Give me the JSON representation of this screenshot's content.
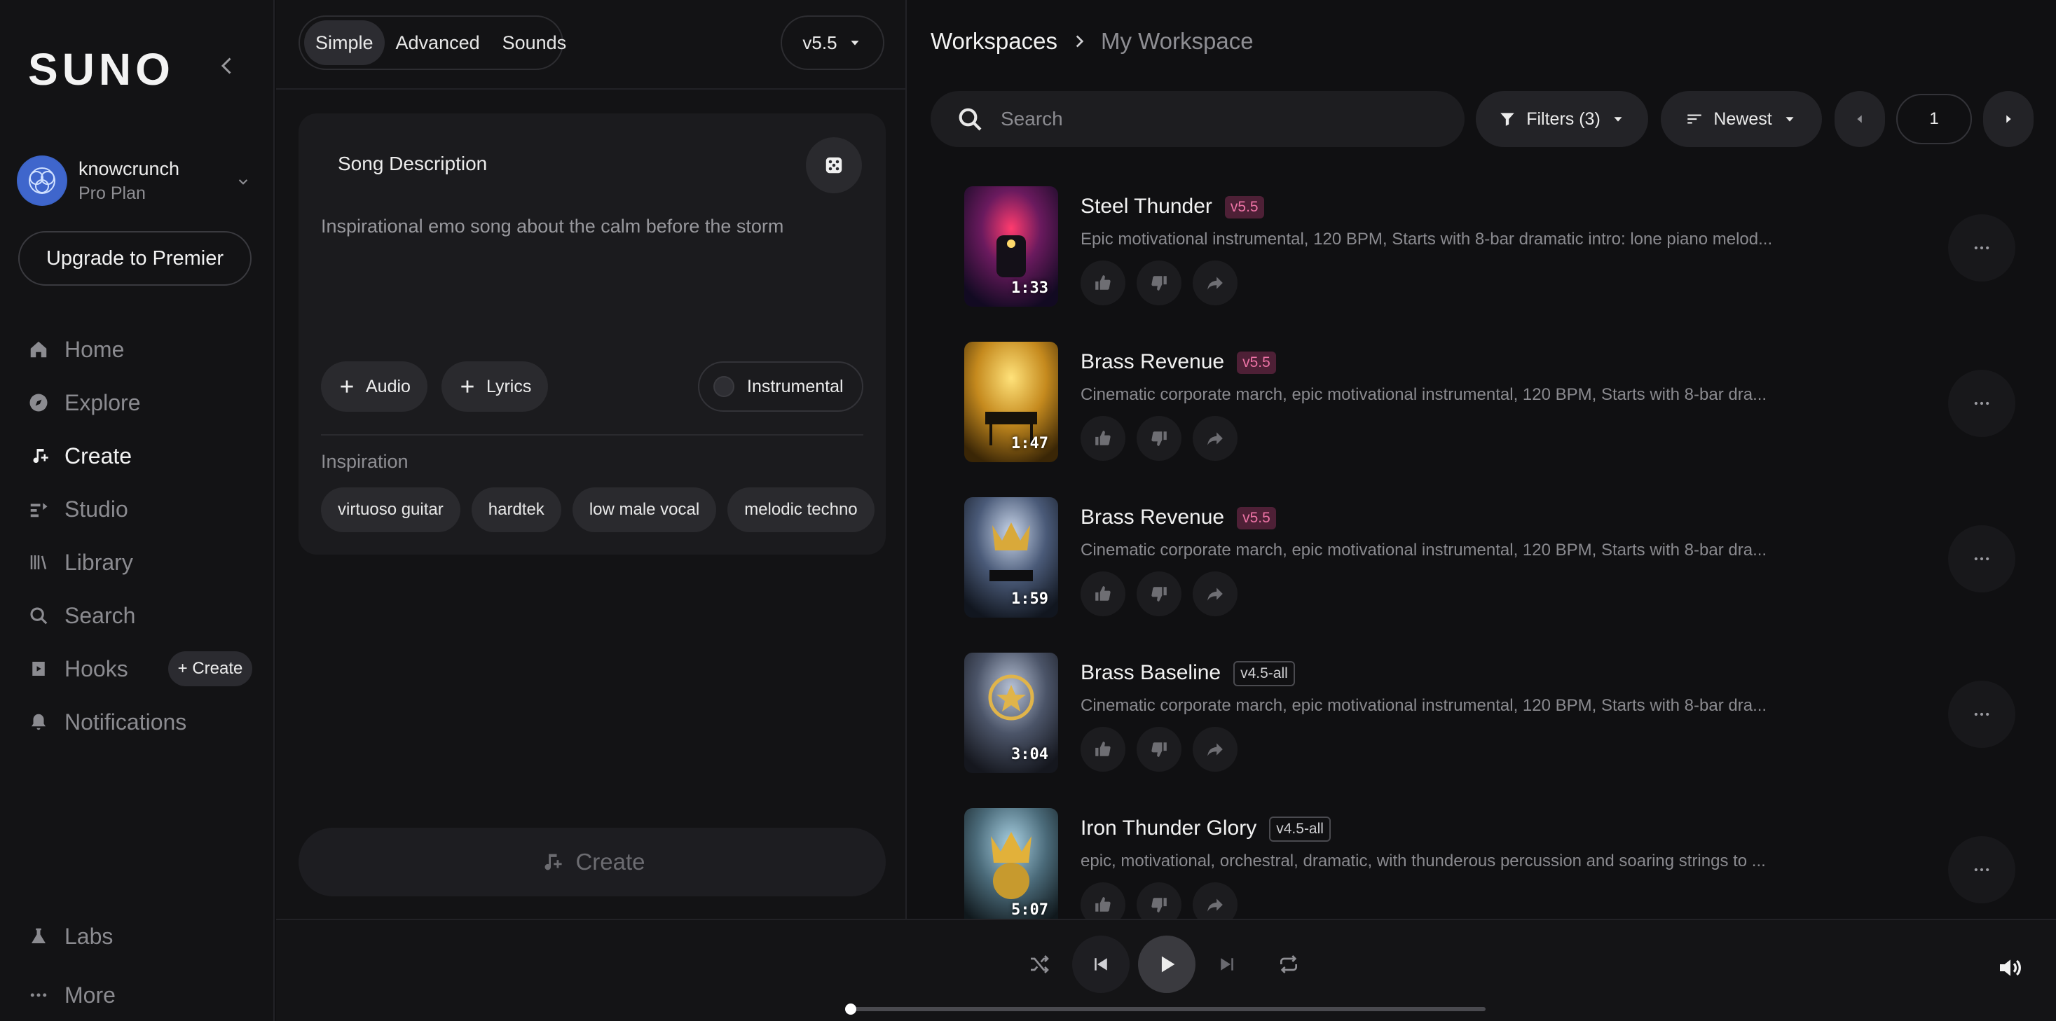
{
  "app": {
    "logo": "SUNO"
  },
  "profile": {
    "name": "knowcrunch",
    "plan": "Pro Plan"
  },
  "sidebar": {
    "upgrade_label": "Upgrade to Premier",
    "items": [
      {
        "label": "Home",
        "icon": "home-icon"
      },
      {
        "label": "Explore",
        "icon": "compass-icon"
      },
      {
        "label": "Create",
        "icon": "music-plus-icon",
        "active": true
      },
      {
        "label": "Studio",
        "icon": "studio-icon"
      },
      {
        "label": "Library",
        "icon": "library-icon"
      },
      {
        "label": "Search",
        "icon": "search-icon"
      },
      {
        "label": "Hooks",
        "icon": "hooks-icon"
      },
      {
        "label": "Notifications",
        "icon": "bell-icon"
      }
    ],
    "hooks_create_label": "+ Create",
    "labs_label": "Labs",
    "more_label": "More"
  },
  "create": {
    "tabs": [
      "Simple",
      "Advanced",
      "Sounds"
    ],
    "active_tab": "Simple",
    "version": "v5.5",
    "description_title": "Song Description",
    "description_value": "Inspirational emo song about the calm before the storm",
    "audio_label": "Audio",
    "lyrics_label": "Lyrics",
    "instrumental_label": "Instrumental",
    "inspiration_label": "Inspiration",
    "inspiration_chips": [
      "virtuoso guitar",
      "hardtek",
      "low male vocal",
      "melodic techno",
      ""
    ],
    "create_label": "Create"
  },
  "workspace": {
    "breadcrumb_root": "Workspaces",
    "breadcrumb_current": "My Workspace",
    "search_placeholder": "Search",
    "filters_label": "Filters (3)",
    "sort_label": "Newest",
    "page": "1"
  },
  "songs": [
    {
      "title": "Steel Thunder",
      "version": "v5.5",
      "badge": "pink",
      "duration": "1:33",
      "description": "Epic motivational instrumental, 120 BPM, Starts with 8-bar dramatic intro: lone piano melod..."
    },
    {
      "title": "Brass Revenue",
      "version": "v5.5",
      "badge": "pink",
      "duration": "1:47",
      "description": "Cinematic corporate march, epic motivational instrumental, 120 BPM, Starts with 8-bar dra..."
    },
    {
      "title": "Brass Revenue",
      "version": "v5.5",
      "badge": "pink",
      "duration": "1:59",
      "description": "Cinematic corporate march, epic motivational instrumental, 120 BPM, Starts with 8-bar dra..."
    },
    {
      "title": "Brass Baseline",
      "version": "v4.5-all",
      "badge": "gray",
      "duration": "3:04",
      "description": "Cinematic corporate march, epic motivational instrumental, 120 BPM, Starts with 8-bar dra..."
    },
    {
      "title": "Iron Thunder Glory",
      "version": "v4.5-all",
      "badge": "gray",
      "duration": "5:07",
      "description": "epic, motivational, orchestral, dramatic, with thunderous percussion and soaring strings to ..."
    }
  ],
  "player": {
    "progress": 0.0
  },
  "colors": {
    "accent_badge_bg": "#4e2036",
    "accent_badge_fg": "#ee73a6",
    "avatar": "#3c64c8"
  }
}
